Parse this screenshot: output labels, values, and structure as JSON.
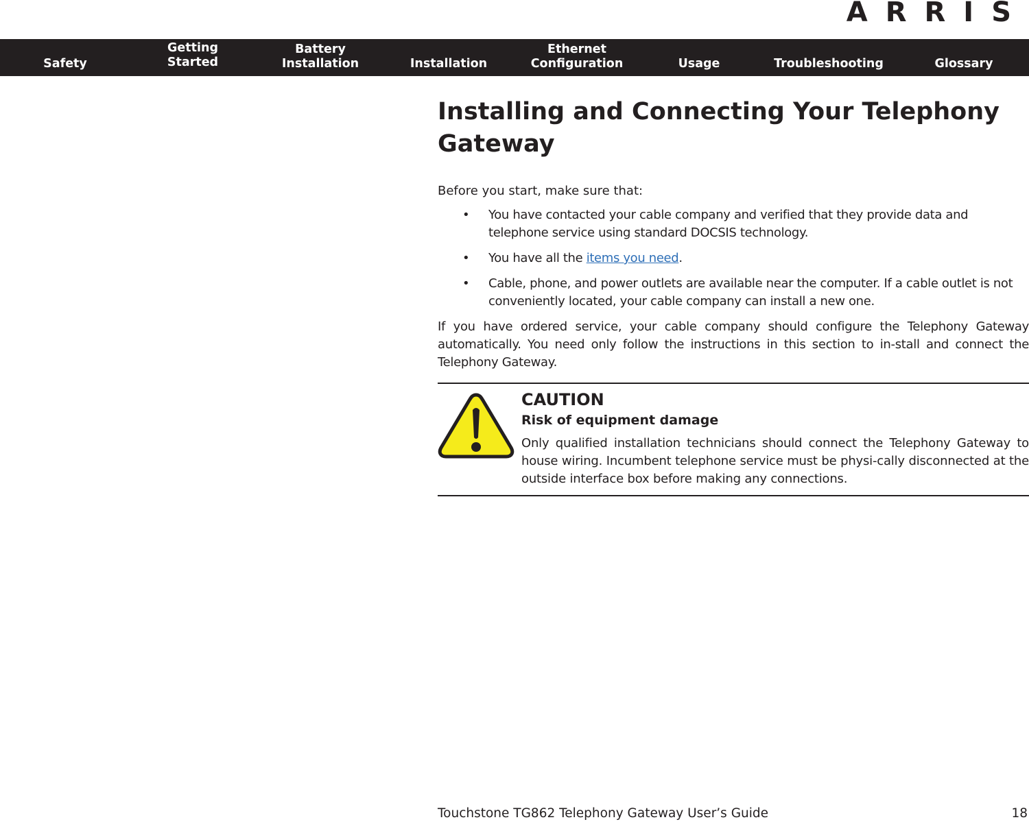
{
  "brand": {
    "logo_text": "ARRIS"
  },
  "nav": {
    "items": [
      {
        "line1": "",
        "line2": "Safety"
      },
      {
        "line1": "Getting",
        "line2": "Started"
      },
      {
        "line1": "Battery",
        "line2": "Installation"
      },
      {
        "line1": "",
        "line2": "Installation"
      },
      {
        "line1": "Ethernet",
        "line2": "Configuration"
      },
      {
        "line1": "",
        "line2": "Usage"
      },
      {
        "line1": "",
        "line2": "Troubleshooting"
      },
      {
        "line1": "",
        "line2": "Glossary"
      }
    ]
  },
  "page": {
    "title": "Installing and Connecting Your Telephony Gateway",
    "intro": "Before you start, make sure that:",
    "bullet_glyph": "•",
    "bullets": [
      {
        "text": "You have contacted your cable company and verified that they provide data and telephone service using standard DOCSIS technology."
      },
      {
        "prefix": "You have all the ",
        "link": "items you need",
        "suffix": "."
      },
      {
        "text": "Cable, phone, and power outlets are available near the computer. If a cable outlet is not conveniently located, your cable company can install a new one."
      }
    ],
    "paragraph": "If you have ordered service, your cable company should configure the Telephony Gateway automatically. You need only follow the instructions in this section to in-stall and connect the Telephony Gateway.",
    "caution": {
      "icon": "warning-triangle-icon",
      "title": "CAUTION",
      "subtitle": "Risk of equipment damage",
      "text": "Only qualified installation technicians should connect the Telephony Gateway to house wiring. Incumbent telephone service must be physi-cally disconnected at the outside interface box before making any connections."
    }
  },
  "footer": {
    "guide_title": "Touchstone TG862 Telephony Gateway User’s Guide",
    "page_number": "18"
  },
  "colors": {
    "navbar_bg": "#231f20",
    "link": "#2e6fb7",
    "caution_yellow": "#f5eb1b"
  }
}
